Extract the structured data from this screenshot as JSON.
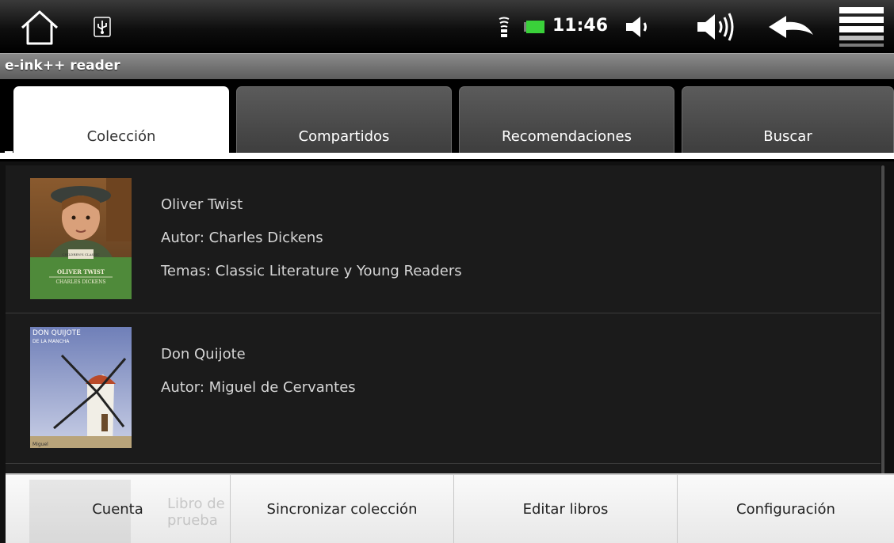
{
  "status_bar": {
    "icons": [
      "home-icon",
      "usb-icon",
      "wifi-icon",
      "battery-icon",
      "volume-down-icon",
      "volume-up-icon",
      "back-icon",
      "menu-icon"
    ],
    "time": "11:46",
    "battery_color": "#3ad13a"
  },
  "app": {
    "title": "e-ink++ reader"
  },
  "tabs": [
    {
      "label": "Colección",
      "active": true
    },
    {
      "label": "Compartidos",
      "active": false
    },
    {
      "label": "Recomendaciones",
      "active": false
    },
    {
      "label": "Buscar",
      "active": false
    }
  ],
  "books": [
    {
      "title": "Oliver Twist",
      "author": "Autor: Charles Dickens",
      "topics": "Temas: Classic Literature y Young Readers",
      "cover_title": "OLIVER TWIST",
      "cover_author": "CHARLES DICKENS",
      "cover_badge": "CHILDREN'S CLASSIC"
    },
    {
      "title": "Don Quijote",
      "author": "Autor: Miguel de Cervantes",
      "topics": "",
      "cover_title": "DON QUIJOTE",
      "cover_subtitle": "DE LA MANCHA",
      "cover_author": "Miguel"
    },
    {
      "title": "Libro de prueba"
    }
  ],
  "menu": {
    "items": [
      "Cuenta",
      "Sincronizar colección",
      "Editar libros",
      "Configuración"
    ]
  }
}
